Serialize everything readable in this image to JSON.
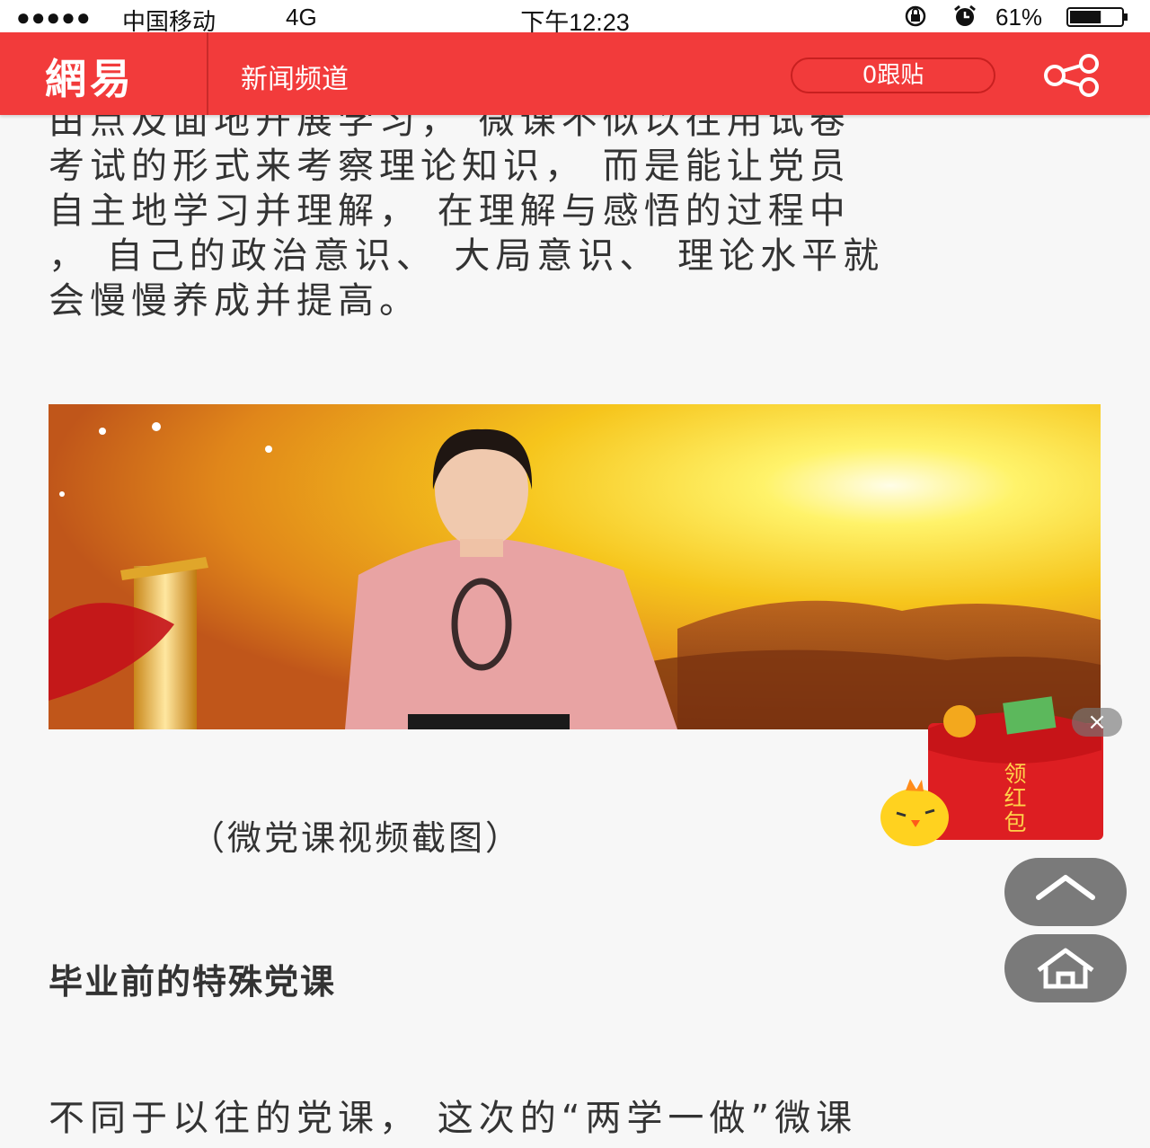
{
  "status_bar": {
    "signal": "●●●●●",
    "carrier": "中国移动",
    "network": "4G",
    "time": "下午12:23",
    "battery_percent": "61%",
    "battery_level": 0.61
  },
  "header": {
    "logo": "網易",
    "channel": "新闻频道",
    "comment_button": "0跟贴",
    "accent_color": "#f23b3b"
  },
  "article": {
    "paragraph_top_lines": [
      "由点及面地开展学习， 微课不似以往用试卷",
      "考试的形式来考察理论知识， 而是能让党员",
      "自主地学习并理解， 在理解与感悟的过程中",
      "， 自己的政治意识、 大局意识、 理论水平就",
      "会慢慢养成并提高。"
    ],
    "caption": "（微党课视频截图）",
    "section_heading": "毕业前的特殊党课",
    "paragraph_bottom": "不同于以往的党课， 这次的“两学一做”微课"
  },
  "floating": {
    "red_envelope_label": "领红包",
    "close_symbol": "×",
    "back_to_top_icon": "chevron-up-icon",
    "home_icon": "home-icon"
  }
}
